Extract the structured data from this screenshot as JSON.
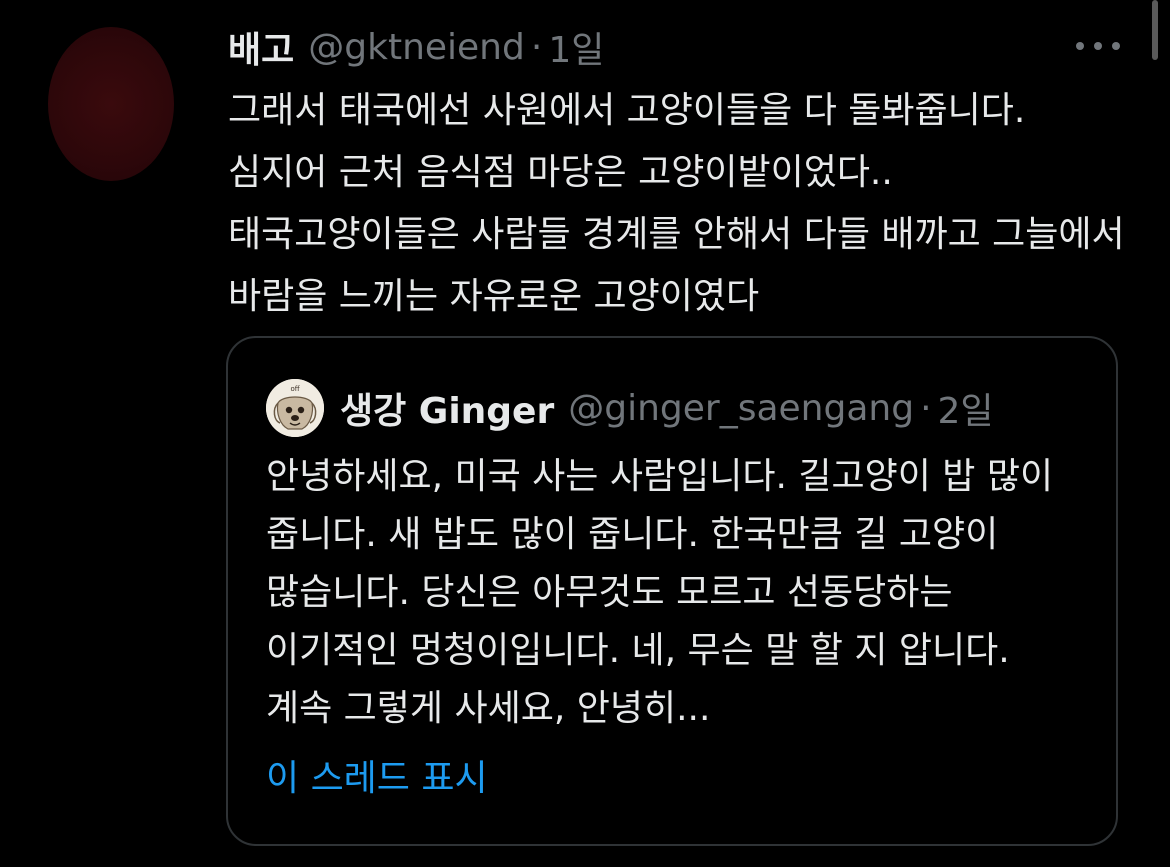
{
  "tweet": {
    "author_name": "배고",
    "handle": "@gktneiend",
    "separator": "·",
    "time": "1일",
    "text": "그래서 태국에선 사원에서 고양이들을 다 돌봐줍니다. 심지어 근처 음식점 마당은 고양이밭이었다.. 태국고양이들은 사람들 경계를 안해서 다들 배까고 그늘에서 바람을 느끼는 자유로운 고양이였다",
    "more_icon": "more-horizontal-icon",
    "avatar_color": "#2d070a"
  },
  "quoted_tweet": {
    "author_name": "생강 Ginger",
    "handle": "@ginger_saengang",
    "separator": "·",
    "time": "2일",
    "text": "안녕하세요, 미국 사는 사람입니다. 길고양이 밥 많이 줍니다. 새 밥도 많이 줍니다. 한국만큼 길 고양이 많습니다. 당신은 아무것도 모르고 선동당하는 이기적인 멍청이입니다. 네, 무슨 말 할 지 압니다. 계속 그렇게 사세요, 안녕히...",
    "show_thread": "이 스레드 표시",
    "avatar_icon": "dog-drawing-avatar"
  },
  "colors": {
    "background": "#000000",
    "text_primary": "#e7e9ea",
    "text_secondary": "#71767b",
    "link": "#1d9bf0",
    "border": "#2f3336"
  }
}
